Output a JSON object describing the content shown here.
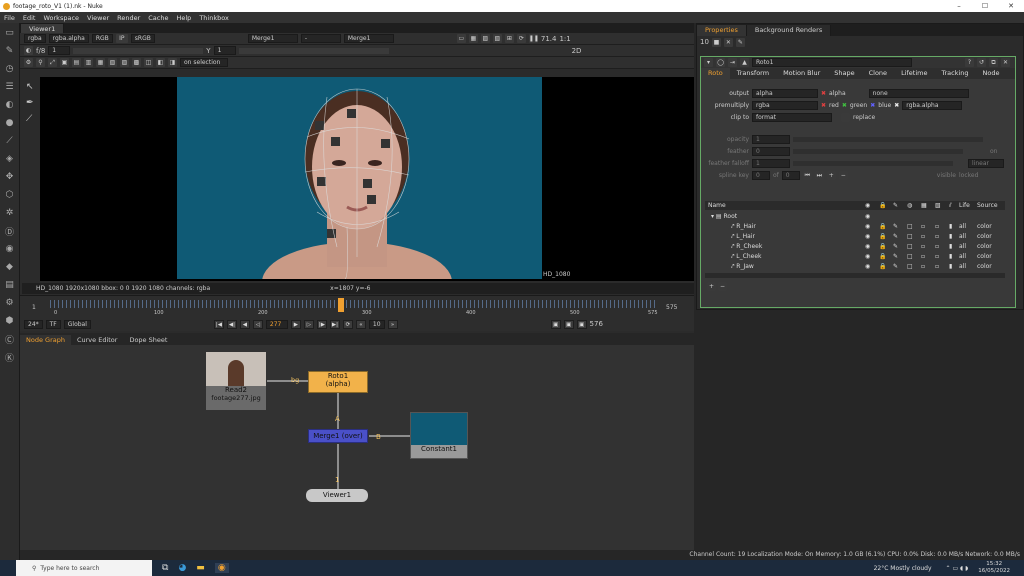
{
  "window": {
    "title": "footage_roto_V1 (1).nk - Nuke",
    "minimize": "–",
    "maximize": "☐",
    "close": "✕"
  },
  "menu": [
    "File",
    "Edit",
    "Workspace",
    "Viewer",
    "Render",
    "Cache",
    "Help",
    "Thinkbox"
  ],
  "viewer_tab": "Viewer1",
  "viewer_controls": {
    "channels": "rgba",
    "layer": "rgba.alpha",
    "colorspace": "RGB",
    "ip": "IP",
    "lut": "sRGB",
    "input_a": "Merge1",
    "dash": "-",
    "input_b": "Merge1",
    "zoom": "1:1",
    "fstop": "71.4",
    "proxy": "2D"
  },
  "viewer_row2": {
    "f_label": "f/8",
    "frame_step": "1",
    "y_label": "Y",
    "y_value": "1",
    "roto_mode": "on selection"
  },
  "viewer_info": {
    "format_label": "HD_1080",
    "info": "HD_1080 1920x1080  bbox: 0 0 1920 1080 channels: rgba",
    "coords": "x=1807 y=-6"
  },
  "timeline": {
    "ticks": [
      "0",
      "100",
      "200",
      "300",
      "400",
      "500",
      "575"
    ],
    "start": "1",
    "end": "575",
    "current": "277"
  },
  "playback": {
    "fps": "24*",
    "tf": "TF",
    "global": "Global",
    "frame": "277",
    "increment": "10",
    "end_frame": "576"
  },
  "node_tabs": [
    "Node Graph",
    "Curve Editor",
    "Dope Sheet"
  ],
  "nodes": {
    "read": {
      "name": "Read2",
      "file": "footage277.jpg"
    },
    "roto": {
      "name": "Roto1",
      "sub": "(alpha)"
    },
    "merge": {
      "name": "Merge1 (over)"
    },
    "constant": {
      "name": "Constant1"
    },
    "viewer": {
      "name": "Viewer1"
    },
    "edge_bg": "bg",
    "edge_a": "A",
    "edge_b": "B",
    "edge_1": "1"
  },
  "properties": {
    "tabs": [
      "Properties",
      "Background Renders"
    ],
    "count": "10",
    "node_name": "Roto1",
    "subtabs": [
      "Roto",
      "Transform",
      "Motion Blur",
      "Shape",
      "Clone",
      "Lifetime",
      "Tracking",
      "Node"
    ],
    "output": {
      "label": "output",
      "value": "alpha",
      "check": "alpha",
      "extra": "none"
    },
    "premultiply": {
      "label": "premultiply",
      "value": "rgba",
      "red": "red",
      "green": "green",
      "blue": "blue",
      "alpha": "rgba.alpha"
    },
    "clip": {
      "label": "clip to",
      "value": "format",
      "replace": "replace"
    },
    "opacity": {
      "label": "opacity",
      "value": "1"
    },
    "feather": {
      "label": "feather",
      "value": "0",
      "on": "on"
    },
    "falloff": {
      "label": "feather falloff",
      "value": "1",
      "mode": "linear"
    },
    "splinekey": {
      "label": "spline key",
      "value": "0",
      "of": "of",
      "total": "0",
      "visible": "visible",
      "locked": "locked"
    },
    "tree_header": {
      "name": "Name",
      "life": "Life",
      "source": "Source"
    },
    "tree_rows": [
      {
        "name": "Root",
        "life": "",
        "source": ""
      },
      {
        "name": "R_Hair",
        "life": "all",
        "source": "color"
      },
      {
        "name": "L_Hair",
        "life": "all",
        "source": "color"
      },
      {
        "name": "R_Cheek",
        "life": "all",
        "source": "color"
      },
      {
        "name": "L_Cheek",
        "life": "all",
        "source": "color"
      },
      {
        "name": "R_Jaw",
        "life": "all",
        "source": "color"
      }
    ]
  },
  "status": "Channel Count: 19  Localization Mode: On  Memory: 1.0 GB (6.1%)  CPU: 0.0%  Disk: 0.0 MB/s  Network: 0.0 MB/s",
  "taskbar": {
    "search": "Type here to search",
    "weather": "22°C  Mostly cloudy",
    "time": "15:32",
    "date": "16/05/2022"
  },
  "colors": {
    "roto_node": "#f2b24a",
    "merge_node": "#4a50c8",
    "constant": "#0f5a75",
    "accent": "#f0a030"
  }
}
